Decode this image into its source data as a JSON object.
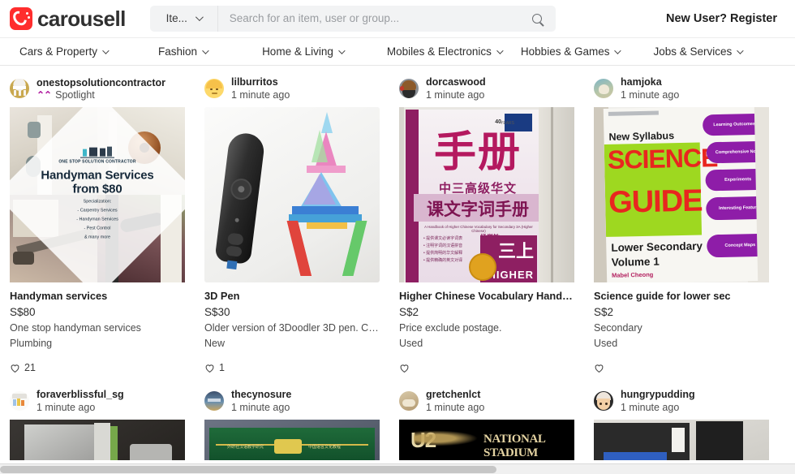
{
  "brand": {
    "name": "carousell",
    "logo_color": "#ff2d2d"
  },
  "header": {
    "search_type_label": "Ite...",
    "search_placeholder": "Search for an item, user or group...",
    "search_value": "",
    "search_icon": "search-icon",
    "register_label": "New User? Register"
  },
  "nav": {
    "items": [
      {
        "label": "Cars & Property"
      },
      {
        "label": "Fashion"
      },
      {
        "label": "Home & Living"
      },
      {
        "label": "Mobiles & Electronics"
      },
      {
        "label": "Hobbies & Games"
      },
      {
        "label": "Jobs & Services"
      }
    ]
  },
  "listings": [
    {
      "seller": "onestopsolutioncontractor",
      "sub": "Spotlight",
      "sub_type": "spotlight",
      "spotlight_icon": "⌃⌃",
      "spotlight_color": "#b0199e",
      "title": "Handyman services",
      "price": "S$80",
      "desc": "One stop handyman services",
      "condition": "Plumbing",
      "likes": "21",
      "image": {
        "kind": "collage",
        "overlay_logo": "ONE STOP SOLUTION CONTRACTOR",
        "overlay_heading_1": "Handyman Services",
        "overlay_heading_2": "from $80",
        "overlay_sub": [
          "Specialization:",
          "- Carpentry Services",
          "- Handyman Services",
          "- Pest Control",
          "& many more"
        ]
      }
    },
    {
      "seller": "lilburritos",
      "sub": "1 minute ago",
      "sub_type": "time",
      "title": "3D Pen",
      "price": "S$30",
      "desc": "Older version of 3Doodler 3D pen. Co...",
      "condition": "New",
      "likes": "1",
      "image": {
        "kind": "pen"
      }
    },
    {
      "seller": "dorcaswood",
      "sub": "1 minute ago",
      "sub_type": "time",
      "title": "Higher Chinese Vocabulary Handbook",
      "price": "S$2",
      "desc": "Price exclude postage.",
      "condition": "Used",
      "likes": "",
      "image": {
        "kind": "chinese-book",
        "cover_years": "40",
        "cover_years_sub": "YEARS",
        "cover_big": "手册",
        "cover_mid": "中三高级华文",
        "cover_line": "课文字词手册",
        "cover_en": "A Handbook of Higher Chinese Vocabulary for Secondary 3A (Higher Chinese)",
        "cover_author": "杨学敏",
        "cover_vol": "三上",
        "cover_higher": "HIGHER"
      }
    },
    {
      "seller": "hamjoka",
      "sub": "1 minute ago",
      "sub_type": "time",
      "title": "Science guide for lower sec",
      "price": "S$2",
      "desc": "Secondary",
      "condition": "Used",
      "likes": "",
      "image": {
        "kind": "science-book",
        "cover_new": "New Syllabus",
        "cover_t1": "SCIENCE",
        "cover_t2": "GUIDE",
        "cover_sub1": "Lower Secondary",
        "cover_sub2": "Volume 1",
        "cover_author": "Mabel Cheong",
        "bubbles": [
          "Learning Outcomes",
          "Comprehensive Notes",
          "Experiments",
          "Interesting Features",
          "Concept Maps"
        ]
      }
    },
    {
      "seller": "foraverblissful_sg",
      "sub": "1 minute ago",
      "sub_type": "time",
      "title": "",
      "price": "",
      "desc": "",
      "condition": "",
      "likes": "",
      "image": {
        "kind": "partial-box"
      }
    },
    {
      "seller": "thecynosure",
      "sub": "1 minute ago",
      "sub_type": "time",
      "title": "",
      "price": "",
      "desc": "",
      "condition": "",
      "likes": "",
      "image": {
        "kind": "partial-green"
      }
    },
    {
      "seller": "gretchenlct",
      "sub": "1 minute ago",
      "sub_type": "time",
      "title": "",
      "price": "",
      "desc": "",
      "condition": "",
      "likes": "",
      "image": {
        "kind": "partial-stadium",
        "text": "NATIONAL STADIUM",
        "text2": "U2"
      }
    },
    {
      "seller": "hungrypudding",
      "sub": "1 minute ago",
      "sub_type": "time",
      "title": "",
      "price": "",
      "desc": "",
      "condition": "",
      "likes": "",
      "image": {
        "kind": "partial-dark"
      }
    }
  ]
}
